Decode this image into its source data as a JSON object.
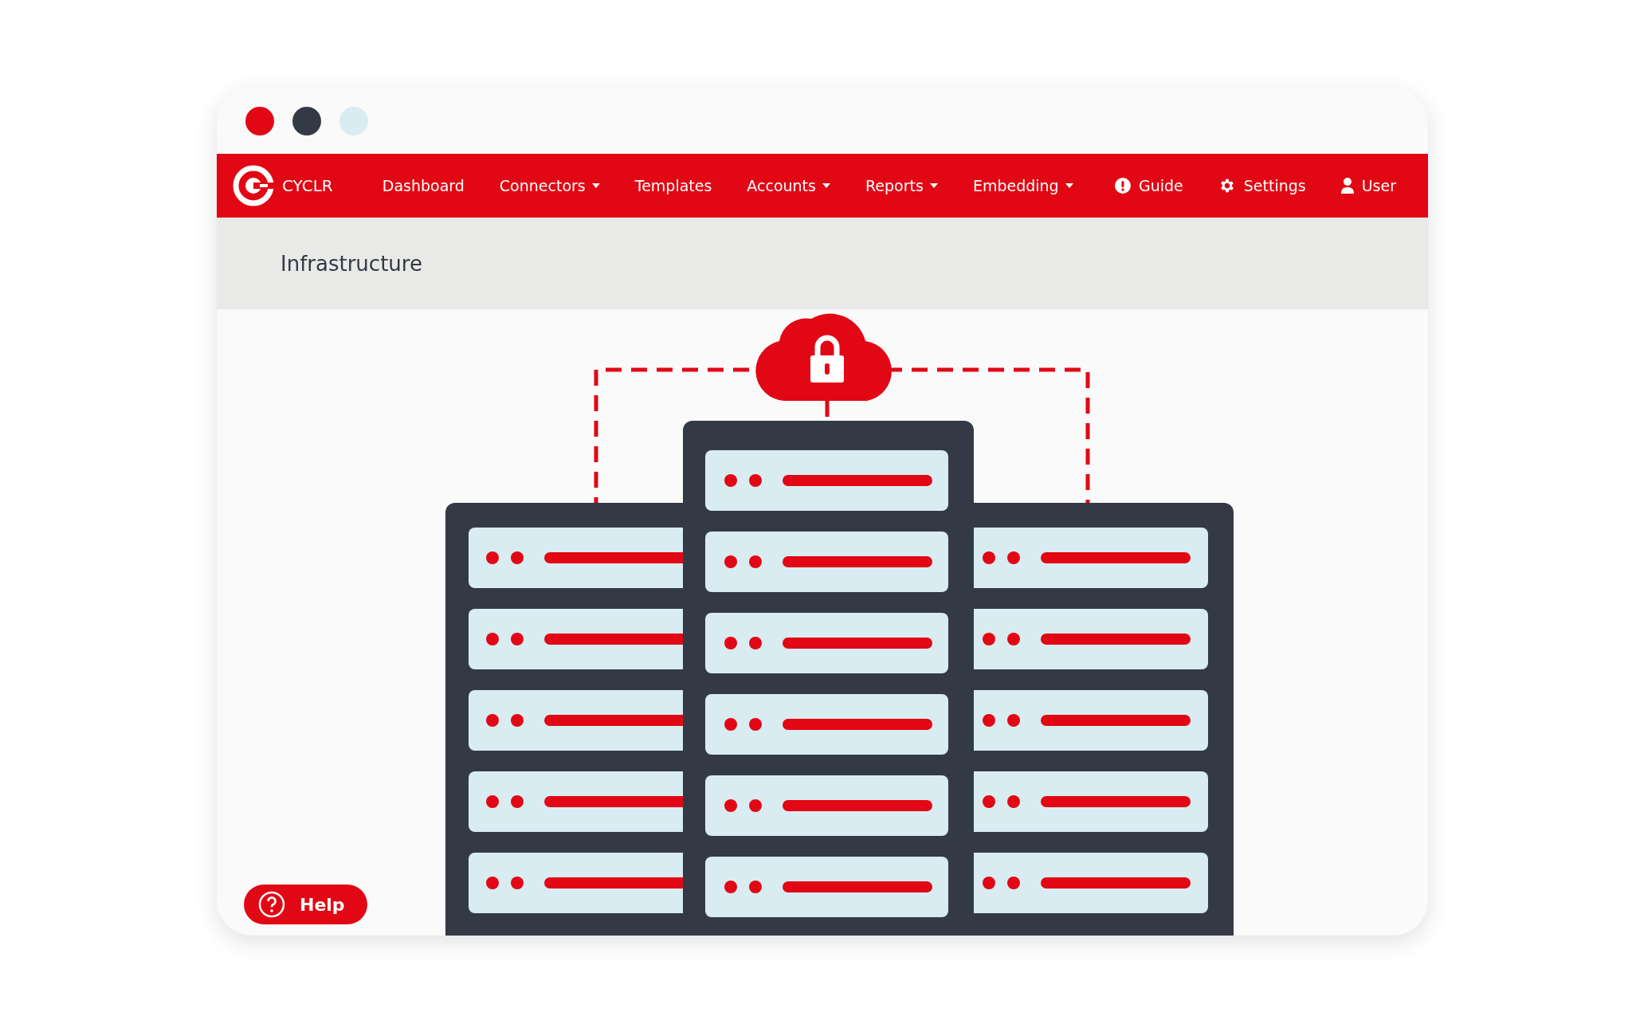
{
  "brand": {
    "name": "CYCLR"
  },
  "nav": [
    {
      "label": "Dashboard",
      "dropdown": false
    },
    {
      "label": "Connectors",
      "dropdown": true
    },
    {
      "label": "Templates",
      "dropdown": false
    },
    {
      "label": "Accounts",
      "dropdown": true
    },
    {
      "label": "Reports",
      "dropdown": true
    },
    {
      "label": "Embedding",
      "dropdown": true
    }
  ],
  "nav_right": [
    {
      "label": "Guide",
      "kind": "guide"
    },
    {
      "label": "Settings",
      "kind": "settings"
    },
    {
      "label": "User",
      "kind": "user"
    }
  ],
  "page": {
    "title": "Infrastructure"
  },
  "help": {
    "label": "Help"
  }
}
